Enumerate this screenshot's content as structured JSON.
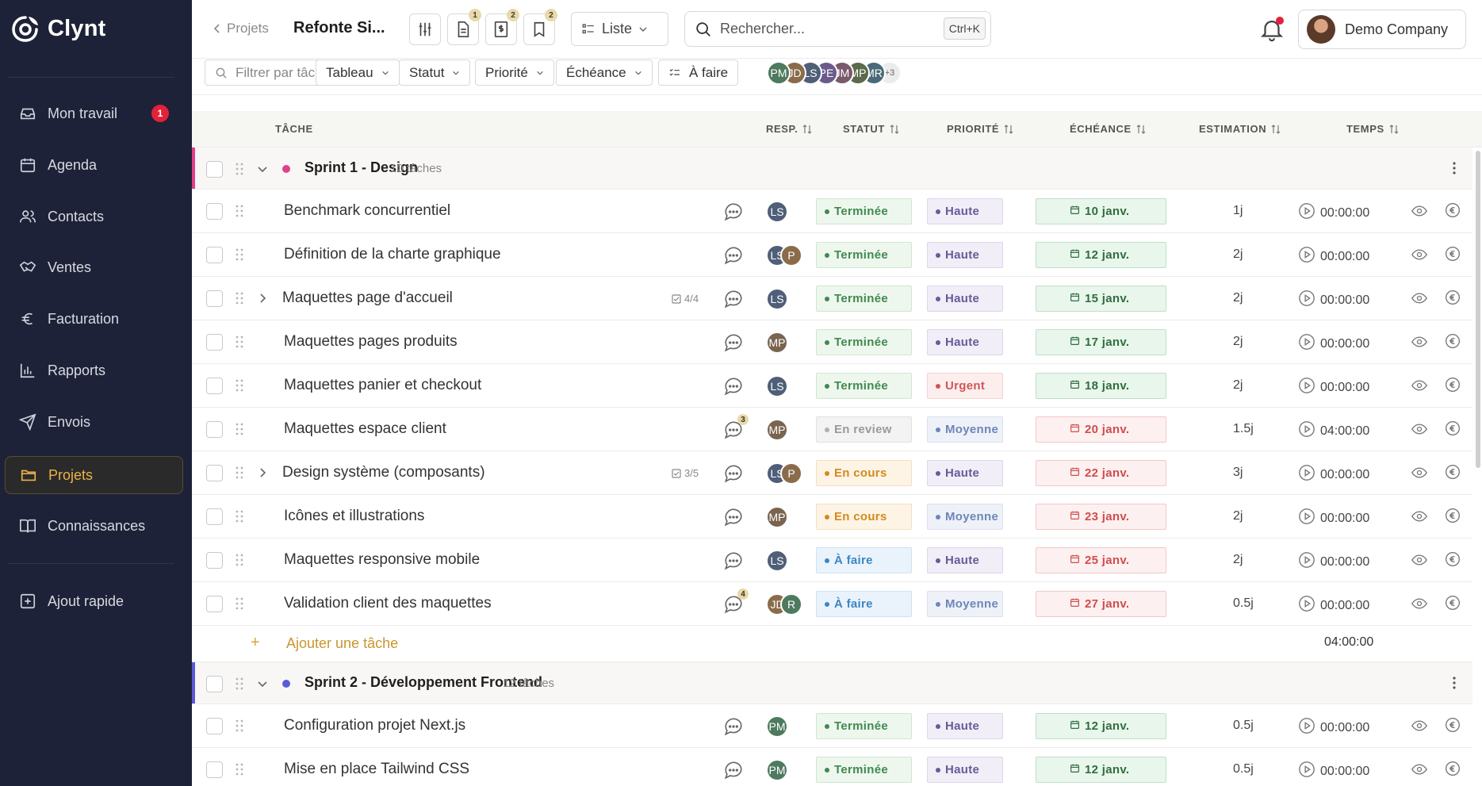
{
  "app": {
    "name": "Clynt"
  },
  "sidebar": {
    "items": [
      {
        "label": "Mon travail",
        "icon": "inbox-icon",
        "badge": "1"
      },
      {
        "label": "Agenda",
        "icon": "calendar-icon"
      },
      {
        "label": "Contacts",
        "icon": "users-icon"
      },
      {
        "label": "Ventes",
        "icon": "handshake-icon"
      },
      {
        "label": "Facturation",
        "icon": "euro-icon"
      },
      {
        "label": "Rapports",
        "icon": "bar-chart-icon"
      },
      {
        "label": "Envois",
        "icon": "send-icon"
      },
      {
        "label": "Projets",
        "icon": "folder-icon",
        "active": true
      },
      {
        "label": "Connaissances",
        "icon": "book-icon"
      },
      {
        "label": "Ajout rapide",
        "icon": "plus-square-icon"
      }
    ]
  },
  "topbar": {
    "back_label": "Projets",
    "title": "Refonte Si...",
    "toolbar_badges": [
      "1",
      "2",
      "2"
    ],
    "view_label": "Liste",
    "search_placeholder": "Rechercher...",
    "search_shortcut": "Ctrl+K",
    "company": "Demo Company"
  },
  "filters": {
    "task_placeholder": "Filtrer par tâche",
    "tableau": "Tableau",
    "statut": "Statut",
    "priorite": "Priorité",
    "echeance": "Échéance",
    "a_faire": "À faire",
    "members": [
      {
        "initials": "PM",
        "color": "#4e7a5e"
      },
      {
        "initials": "JD",
        "color": "#8a6b4a"
      },
      {
        "initials": "LS",
        "color": "#4f5f78"
      },
      {
        "initials": "PE",
        "color": "#6b5b8c"
      },
      {
        "initials": "JM",
        "color": "#7a5a6a"
      },
      {
        "initials": "MP",
        "color": "#5a6a4a"
      },
      {
        "initials": "MR",
        "color": "#4a6a7a"
      }
    ],
    "more": "+3"
  },
  "columns": {
    "tache": "TÂCHE",
    "resp": "RESP.",
    "statut": "STATUT",
    "priorite": "PRIORITÉ",
    "echeance": "ÉCHÉANCE",
    "estimation": "ESTIMATION",
    "temps": "TEMPS"
  },
  "colors": {
    "avatar_LS": "#4f5f78",
    "avatar_MP": "#7a6450",
    "avatar_PM": "#4e7a5e",
    "avatar_P": "#8a6b4a",
    "avatar_JD": "#8a6b4a",
    "avatar_R": "#4e7a5e",
    "group1": "#e0408a",
    "group2": "#5a5ad8"
  },
  "groups": [
    {
      "name": "Sprint 1 - Design",
      "count": "10 tâches",
      "color": "#e0408a",
      "add_label": "Ajouter une tâche",
      "total": "04:00:00",
      "tasks": [
        {
          "name": "Benchmark concurrentiel",
          "resp": [
            "LS"
          ],
          "statut": "Terminée",
          "priorite": "Haute",
          "echeance": "10 janv.",
          "overdue": false,
          "estimation": "1j",
          "temps": "00:00:00"
        },
        {
          "name": "Définition de la charte graphique",
          "resp": [
            "LS",
            "P"
          ],
          "statut": "Terminée",
          "priorite": "Haute",
          "echeance": "12 janv.",
          "overdue": false,
          "estimation": "2j",
          "temps": "00:00:00"
        },
        {
          "name": "Maquettes page d'accueil",
          "expandable": true,
          "subtasks": "4/4",
          "resp": [
            "LS"
          ],
          "statut": "Terminée",
          "priorite": "Haute",
          "echeance": "15 janv.",
          "overdue": false,
          "estimation": "2j",
          "temps": "00:00:00"
        },
        {
          "name": "Maquettes pages produits",
          "resp": [
            "MP"
          ],
          "statut": "Terminée",
          "priorite": "Haute",
          "echeance": "17 janv.",
          "overdue": false,
          "estimation": "2j",
          "temps": "00:00:00"
        },
        {
          "name": "Maquettes panier et checkout",
          "resp": [
            "LS"
          ],
          "statut": "Terminée",
          "priorite": "Urgent",
          "echeance": "18 janv.",
          "overdue": false,
          "estimation": "2j",
          "temps": "00:00:00"
        },
        {
          "name": "Maquettes espace client",
          "comments": "3",
          "resp": [
            "MP"
          ],
          "statut": "En review",
          "priorite": "Moyenne",
          "echeance": "20 janv.",
          "overdue": true,
          "estimation": "1.5j",
          "temps": "04:00:00"
        },
        {
          "name": "Design système (composants)",
          "expandable": true,
          "subtasks": "3/5",
          "resp": [
            "LS",
            "P"
          ],
          "statut": "En cours",
          "priorite": "Haute",
          "echeance": "22 janv.",
          "overdue": true,
          "estimation": "3j",
          "temps": "00:00:00"
        },
        {
          "name": "Icônes et illustrations",
          "resp": [
            "MP"
          ],
          "statut": "En cours",
          "priorite": "Moyenne",
          "echeance": "23 janv.",
          "overdue": true,
          "estimation": "2j",
          "temps": "00:00:00"
        },
        {
          "name": "Maquettes responsive mobile",
          "resp": [
            "LS"
          ],
          "statut": "À faire",
          "priorite": "Haute",
          "echeance": "25 janv.",
          "overdue": true,
          "estimation": "2j",
          "temps": "00:00:00"
        },
        {
          "name": "Validation client des maquettes",
          "comments": "4",
          "resp": [
            "JD",
            "R"
          ],
          "statut": "À faire",
          "priorite": "Moyenne",
          "echeance": "27 janv.",
          "overdue": true,
          "estimation": "0.5j",
          "temps": "00:00:00"
        }
      ]
    },
    {
      "name": "Sprint 2 - Développement Frontend",
      "count": "12 tâches",
      "color": "#5a5ad8",
      "tasks": [
        {
          "name": "Configuration projet Next.js",
          "resp": [
            "PM"
          ],
          "statut": "Terminée",
          "priorite": "Haute",
          "echeance": "12 janv.",
          "overdue": false,
          "estimation": "0.5j",
          "temps": "00:00:00"
        },
        {
          "name": "Mise en place Tailwind CSS",
          "resp": [
            "PM"
          ],
          "statut": "Terminée",
          "priorite": "Haute",
          "echeance": "12 janv.",
          "overdue": false,
          "estimation": "0.5j",
          "temps": "00:00:00"
        }
      ]
    }
  ]
}
